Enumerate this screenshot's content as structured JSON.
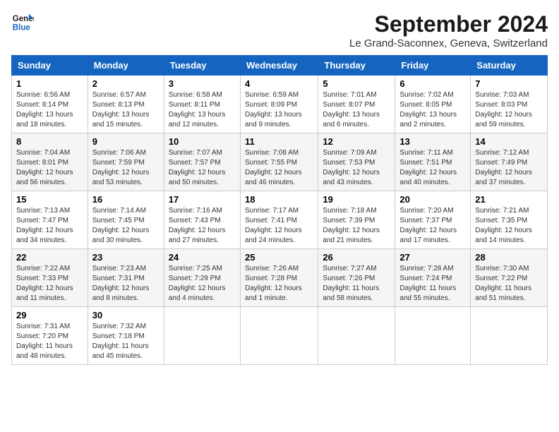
{
  "logo": {
    "line1": "General",
    "line2": "Blue"
  },
  "title": "September 2024",
  "location": "Le Grand-Saconnex, Geneva, Switzerland",
  "days_of_week": [
    "Sunday",
    "Monday",
    "Tuesday",
    "Wednesday",
    "Thursday",
    "Friday",
    "Saturday"
  ],
  "weeks": [
    [
      {
        "day": "1",
        "sunrise": "6:56 AM",
        "sunset": "8:14 PM",
        "daylight": "13 hours and 18 minutes."
      },
      {
        "day": "2",
        "sunrise": "6:57 AM",
        "sunset": "8:13 PM",
        "daylight": "13 hours and 15 minutes."
      },
      {
        "day": "3",
        "sunrise": "6:58 AM",
        "sunset": "8:11 PM",
        "daylight": "13 hours and 12 minutes."
      },
      {
        "day": "4",
        "sunrise": "6:59 AM",
        "sunset": "8:09 PM",
        "daylight": "13 hours and 9 minutes."
      },
      {
        "day": "5",
        "sunrise": "7:01 AM",
        "sunset": "8:07 PM",
        "daylight": "13 hours and 6 minutes."
      },
      {
        "day": "6",
        "sunrise": "7:02 AM",
        "sunset": "8:05 PM",
        "daylight": "13 hours and 2 minutes."
      },
      {
        "day": "7",
        "sunrise": "7:03 AM",
        "sunset": "8:03 PM",
        "daylight": "12 hours and 59 minutes."
      }
    ],
    [
      {
        "day": "8",
        "sunrise": "7:04 AM",
        "sunset": "8:01 PM",
        "daylight": "12 hours and 56 minutes."
      },
      {
        "day": "9",
        "sunrise": "7:06 AM",
        "sunset": "7:59 PM",
        "daylight": "12 hours and 53 minutes."
      },
      {
        "day": "10",
        "sunrise": "7:07 AM",
        "sunset": "7:57 PM",
        "daylight": "12 hours and 50 minutes."
      },
      {
        "day": "11",
        "sunrise": "7:08 AM",
        "sunset": "7:55 PM",
        "daylight": "12 hours and 46 minutes."
      },
      {
        "day": "12",
        "sunrise": "7:09 AM",
        "sunset": "7:53 PM",
        "daylight": "12 hours and 43 minutes."
      },
      {
        "day": "13",
        "sunrise": "7:11 AM",
        "sunset": "7:51 PM",
        "daylight": "12 hours and 40 minutes."
      },
      {
        "day": "14",
        "sunrise": "7:12 AM",
        "sunset": "7:49 PM",
        "daylight": "12 hours and 37 minutes."
      }
    ],
    [
      {
        "day": "15",
        "sunrise": "7:13 AM",
        "sunset": "7:47 PM",
        "daylight": "12 hours and 34 minutes."
      },
      {
        "day": "16",
        "sunrise": "7:14 AM",
        "sunset": "7:45 PM",
        "daylight": "12 hours and 30 minutes."
      },
      {
        "day": "17",
        "sunrise": "7:16 AM",
        "sunset": "7:43 PM",
        "daylight": "12 hours and 27 minutes."
      },
      {
        "day": "18",
        "sunrise": "7:17 AM",
        "sunset": "7:41 PM",
        "daylight": "12 hours and 24 minutes."
      },
      {
        "day": "19",
        "sunrise": "7:18 AM",
        "sunset": "7:39 PM",
        "daylight": "12 hours and 21 minutes."
      },
      {
        "day": "20",
        "sunrise": "7:20 AM",
        "sunset": "7:37 PM",
        "daylight": "12 hours and 17 minutes."
      },
      {
        "day": "21",
        "sunrise": "7:21 AM",
        "sunset": "7:35 PM",
        "daylight": "12 hours and 14 minutes."
      }
    ],
    [
      {
        "day": "22",
        "sunrise": "7:22 AM",
        "sunset": "7:33 PM",
        "daylight": "12 hours and 11 minutes."
      },
      {
        "day": "23",
        "sunrise": "7:23 AM",
        "sunset": "7:31 PM",
        "daylight": "12 hours and 8 minutes."
      },
      {
        "day": "24",
        "sunrise": "7:25 AM",
        "sunset": "7:29 PM",
        "daylight": "12 hours and 4 minutes."
      },
      {
        "day": "25",
        "sunrise": "7:26 AM",
        "sunset": "7:28 PM",
        "daylight": "12 hours and 1 minute."
      },
      {
        "day": "26",
        "sunrise": "7:27 AM",
        "sunset": "7:26 PM",
        "daylight": "11 hours and 58 minutes."
      },
      {
        "day": "27",
        "sunrise": "7:28 AM",
        "sunset": "7:24 PM",
        "daylight": "11 hours and 55 minutes."
      },
      {
        "day": "28",
        "sunrise": "7:30 AM",
        "sunset": "7:22 PM",
        "daylight": "11 hours and 51 minutes."
      }
    ],
    [
      {
        "day": "29",
        "sunrise": "7:31 AM",
        "sunset": "7:20 PM",
        "daylight": "11 hours and 48 minutes."
      },
      {
        "day": "30",
        "sunrise": "7:32 AM",
        "sunset": "7:18 PM",
        "daylight": "11 hours and 45 minutes."
      },
      null,
      null,
      null,
      null,
      null
    ]
  ]
}
